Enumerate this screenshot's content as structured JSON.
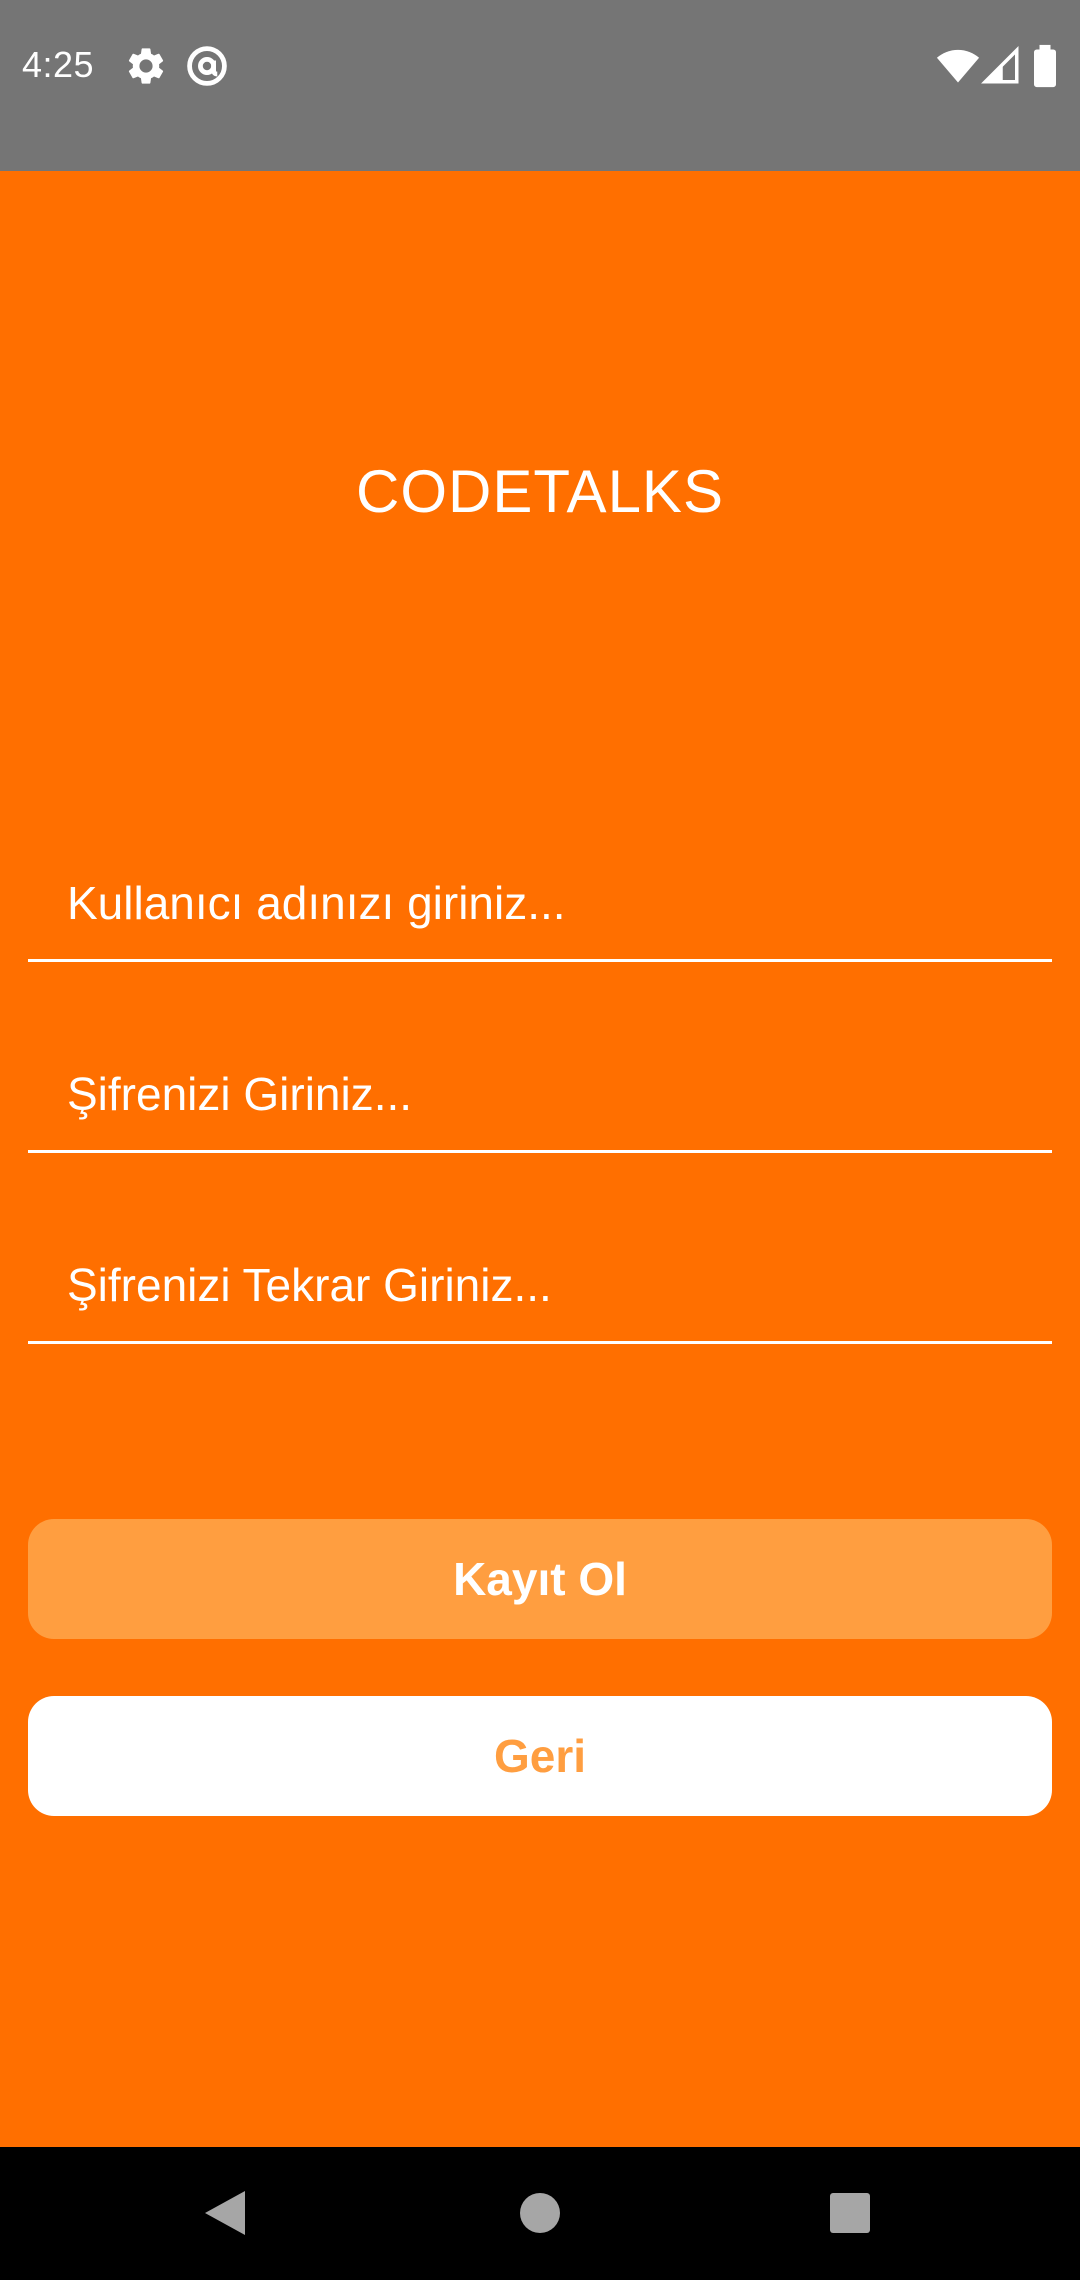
{
  "status_bar": {
    "time": "4:25",
    "icons": [
      "gear-icon",
      "at-sign-icon",
      "wifi-icon",
      "signal-icon",
      "battery-icon"
    ],
    "background": "#757575"
  },
  "app": {
    "title": "CODETALKS",
    "background": "#FF6F00",
    "form": {
      "username_placeholder": "Kullanıcı adınızı giriniz...",
      "password_placeholder": "Şifrenizi Giriniz...",
      "password_repeat_placeholder": "Şifrenizi Tekrar Giriniz..."
    },
    "buttons": {
      "register_label": "Kayıt Ol",
      "register_color": "#FF9E40",
      "back_label": "Geri",
      "back_color": "#FFFFFF"
    }
  },
  "nav_bar": {
    "icons": [
      "back-icon",
      "home-icon",
      "recents-icon"
    ]
  }
}
